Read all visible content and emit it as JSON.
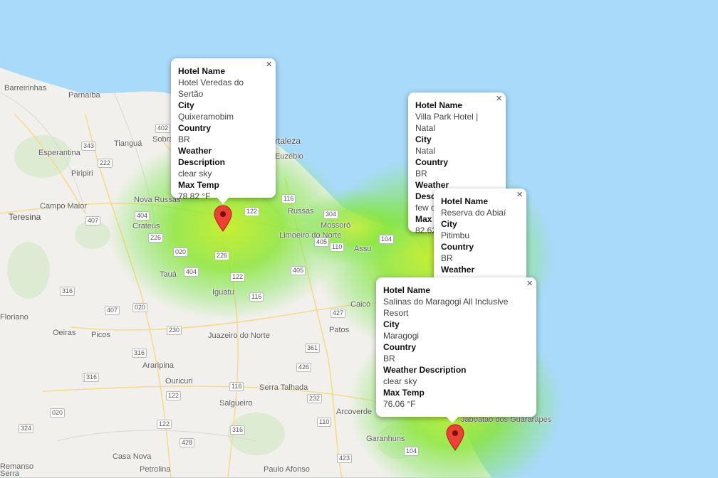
{
  "map": {
    "places": [
      {
        "name": "Barreirinhas"
      },
      {
        "name": "Parnaíba"
      },
      {
        "name": "Tianguá"
      },
      {
        "name": "Sobral"
      },
      {
        "name": "Esperantina"
      },
      {
        "name": "Piripiri"
      },
      {
        "name": "Teresina"
      },
      {
        "name": "Campo Maior"
      },
      {
        "name": "Nova Russas"
      },
      {
        "name": "Crateús"
      },
      {
        "name": "Tauá"
      },
      {
        "name": "Russas"
      },
      {
        "name": "Limoeiro do Norte"
      },
      {
        "name": "Mossoró"
      },
      {
        "name": "Assu"
      },
      {
        "name": "Iguatu"
      },
      {
        "name": "Caicó"
      },
      {
        "name": "Floriano"
      },
      {
        "name": "Oeiras"
      },
      {
        "name": "Picos"
      },
      {
        "name": "Juazeiro do Norte"
      },
      {
        "name": "Patos"
      },
      {
        "name": "Araripina"
      },
      {
        "name": "Ouricuri"
      },
      {
        "name": "Serra Talhada"
      },
      {
        "name": "Salgueiro"
      },
      {
        "name": "Arcoverde"
      },
      {
        "name": "Garanhuns"
      },
      {
        "name": "Casa Nova"
      },
      {
        "name": "Petrolina"
      },
      {
        "name": "Paulo Afonso"
      },
      {
        "name": "Remanso"
      },
      {
        "name": "Euzébio"
      },
      {
        "name": "Fortaleza"
      },
      {
        "name": "Serra"
      },
      {
        "name": "Jaboatão dos Guararapes"
      }
    ],
    "shields": [
      "343",
      "222",
      "402",
      "407",
      "404",
      "226",
      "020",
      "404",
      "122",
      "226",
      "116",
      "304",
      "405",
      "110",
      "104",
      "405",
      "116",
      "316",
      "407",
      "020",
      "230",
      "427",
      "361",
      "316",
      "426",
      "232",
      "020",
      "122",
      "116",
      "316",
      "110",
      "324",
      "428",
      "122",
      "423",
      "104",
      "020",
      "316",
      "122"
    ]
  },
  "popups": [
    {
      "hotel_label": "Hotel Name",
      "hotel": "Hotel Veredas do Sertão",
      "city_label": "City",
      "city": "Quixeramobim",
      "country_label": "Country",
      "country": "BR",
      "weather_label": "Weather Description",
      "weather": "clear sky",
      "temp_label": "Max Temp",
      "temp": "78.82 °F"
    },
    {
      "hotel_label": "Hotel Name",
      "hotel": "Villa Park Hotel | Natal",
      "city_label": "City",
      "city": "Natal",
      "country_label": "Country",
      "country": "BR",
      "weather_label": "Weather Description",
      "weather": "few clouds",
      "temp_label": "Max Temp",
      "temp": "82.62 °F"
    },
    {
      "hotel_label": "Hotel Name",
      "hotel": "Reserva do Abiaí",
      "city_label": "City",
      "city": "Pitimbu",
      "country_label": "Country",
      "country": "BR",
      "weather_label": "Weather Description"
    },
    {
      "hotel_label": "Hotel Name",
      "hotel": "Salinas do Maragogi All Inclusive Resort",
      "city_label": "City",
      "city": "Maragogi",
      "country_label": "Country",
      "country": "BR",
      "weather_label": "Weather Description",
      "weather": "clear sky",
      "temp_label": "Max Temp",
      "temp": "76.06 °F"
    }
  ],
  "close_glyph": "×",
  "colors": {
    "ocean": "#a9dafa",
    "land": "#f1f0ec",
    "heat": "#9be82f",
    "marker": "#ea4335"
  }
}
